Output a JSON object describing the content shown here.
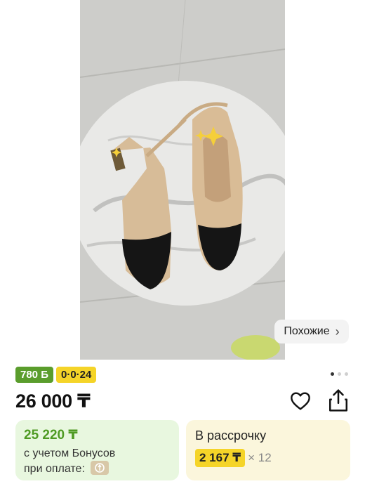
{
  "gallery": {
    "similar_label": "Похожие",
    "pager_count": 3,
    "pager_active": 1
  },
  "badges": {
    "bonus": "780 Б",
    "installment_plan": "0·0·24"
  },
  "price": "26 000 ₸",
  "bonus_card": {
    "price": "25 220 ₸",
    "line1": "с учетом Бонусов",
    "line2": "при оплате:"
  },
  "installment_card": {
    "title": "В рассрочку",
    "amount": "2 167 ₸",
    "multiplier": "× 12"
  },
  "colors": {
    "accent_green": "#5a9d2c",
    "accent_yellow": "#f5d428",
    "bonus_bg": "#e8f7df",
    "install_bg": "#fbf6dc"
  },
  "icons": [
    "chevron-right-icon",
    "heart-icon",
    "share-icon",
    "kaspi-pay-icon"
  ]
}
